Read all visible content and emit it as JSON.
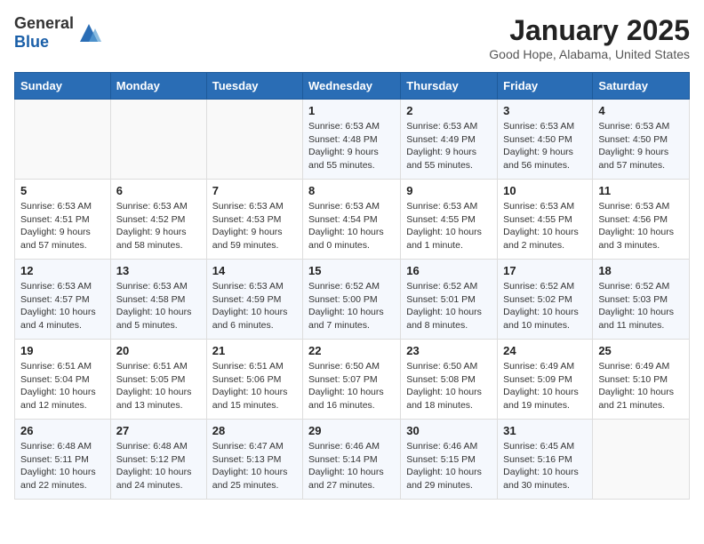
{
  "header": {
    "logo_general": "General",
    "logo_blue": "Blue",
    "title": "January 2025",
    "location": "Good Hope, Alabama, United States"
  },
  "days_of_week": [
    "Sunday",
    "Monday",
    "Tuesday",
    "Wednesday",
    "Thursday",
    "Friday",
    "Saturday"
  ],
  "weeks": [
    [
      {
        "day": "",
        "content": ""
      },
      {
        "day": "",
        "content": ""
      },
      {
        "day": "",
        "content": ""
      },
      {
        "day": "1",
        "content": "Sunrise: 6:53 AM\nSunset: 4:48 PM\nDaylight: 9 hours and 55 minutes."
      },
      {
        "day": "2",
        "content": "Sunrise: 6:53 AM\nSunset: 4:49 PM\nDaylight: 9 hours and 55 minutes."
      },
      {
        "day": "3",
        "content": "Sunrise: 6:53 AM\nSunset: 4:50 PM\nDaylight: 9 hours and 56 minutes."
      },
      {
        "day": "4",
        "content": "Sunrise: 6:53 AM\nSunset: 4:50 PM\nDaylight: 9 hours and 57 minutes."
      }
    ],
    [
      {
        "day": "5",
        "content": "Sunrise: 6:53 AM\nSunset: 4:51 PM\nDaylight: 9 hours and 57 minutes."
      },
      {
        "day": "6",
        "content": "Sunrise: 6:53 AM\nSunset: 4:52 PM\nDaylight: 9 hours and 58 minutes."
      },
      {
        "day": "7",
        "content": "Sunrise: 6:53 AM\nSunset: 4:53 PM\nDaylight: 9 hours and 59 minutes."
      },
      {
        "day": "8",
        "content": "Sunrise: 6:53 AM\nSunset: 4:54 PM\nDaylight: 10 hours and 0 minutes."
      },
      {
        "day": "9",
        "content": "Sunrise: 6:53 AM\nSunset: 4:55 PM\nDaylight: 10 hours and 1 minute."
      },
      {
        "day": "10",
        "content": "Sunrise: 6:53 AM\nSunset: 4:55 PM\nDaylight: 10 hours and 2 minutes."
      },
      {
        "day": "11",
        "content": "Sunrise: 6:53 AM\nSunset: 4:56 PM\nDaylight: 10 hours and 3 minutes."
      }
    ],
    [
      {
        "day": "12",
        "content": "Sunrise: 6:53 AM\nSunset: 4:57 PM\nDaylight: 10 hours and 4 minutes."
      },
      {
        "day": "13",
        "content": "Sunrise: 6:53 AM\nSunset: 4:58 PM\nDaylight: 10 hours and 5 minutes."
      },
      {
        "day": "14",
        "content": "Sunrise: 6:53 AM\nSunset: 4:59 PM\nDaylight: 10 hours and 6 minutes."
      },
      {
        "day": "15",
        "content": "Sunrise: 6:52 AM\nSunset: 5:00 PM\nDaylight: 10 hours and 7 minutes."
      },
      {
        "day": "16",
        "content": "Sunrise: 6:52 AM\nSunset: 5:01 PM\nDaylight: 10 hours and 8 minutes."
      },
      {
        "day": "17",
        "content": "Sunrise: 6:52 AM\nSunset: 5:02 PM\nDaylight: 10 hours and 10 minutes."
      },
      {
        "day": "18",
        "content": "Sunrise: 6:52 AM\nSunset: 5:03 PM\nDaylight: 10 hours and 11 minutes."
      }
    ],
    [
      {
        "day": "19",
        "content": "Sunrise: 6:51 AM\nSunset: 5:04 PM\nDaylight: 10 hours and 12 minutes."
      },
      {
        "day": "20",
        "content": "Sunrise: 6:51 AM\nSunset: 5:05 PM\nDaylight: 10 hours and 13 minutes."
      },
      {
        "day": "21",
        "content": "Sunrise: 6:51 AM\nSunset: 5:06 PM\nDaylight: 10 hours and 15 minutes."
      },
      {
        "day": "22",
        "content": "Sunrise: 6:50 AM\nSunset: 5:07 PM\nDaylight: 10 hours and 16 minutes."
      },
      {
        "day": "23",
        "content": "Sunrise: 6:50 AM\nSunset: 5:08 PM\nDaylight: 10 hours and 18 minutes."
      },
      {
        "day": "24",
        "content": "Sunrise: 6:49 AM\nSunset: 5:09 PM\nDaylight: 10 hours and 19 minutes."
      },
      {
        "day": "25",
        "content": "Sunrise: 6:49 AM\nSunset: 5:10 PM\nDaylight: 10 hours and 21 minutes."
      }
    ],
    [
      {
        "day": "26",
        "content": "Sunrise: 6:48 AM\nSunset: 5:11 PM\nDaylight: 10 hours and 22 minutes."
      },
      {
        "day": "27",
        "content": "Sunrise: 6:48 AM\nSunset: 5:12 PM\nDaylight: 10 hours and 24 minutes."
      },
      {
        "day": "28",
        "content": "Sunrise: 6:47 AM\nSunset: 5:13 PM\nDaylight: 10 hours and 25 minutes."
      },
      {
        "day": "29",
        "content": "Sunrise: 6:46 AM\nSunset: 5:14 PM\nDaylight: 10 hours and 27 minutes."
      },
      {
        "day": "30",
        "content": "Sunrise: 6:46 AM\nSunset: 5:15 PM\nDaylight: 10 hours and 29 minutes."
      },
      {
        "day": "31",
        "content": "Sunrise: 6:45 AM\nSunset: 5:16 PM\nDaylight: 10 hours and 30 minutes."
      },
      {
        "day": "",
        "content": ""
      }
    ]
  ]
}
